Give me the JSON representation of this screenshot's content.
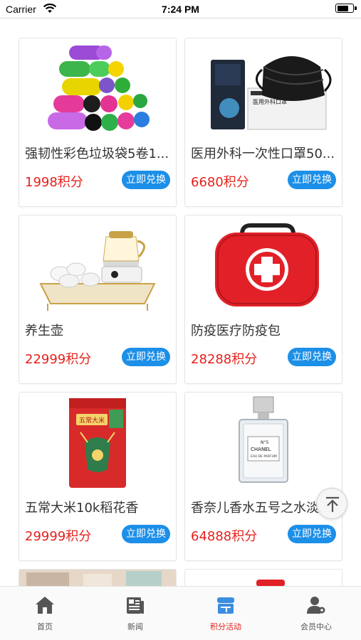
{
  "status_bar": {
    "carrier": "Carrier",
    "time": "7:24 PM"
  },
  "products": [
    {
      "title": "强韧性彩色垃圾袋5卷1...",
      "price": "1998积分",
      "button": "立即兑换",
      "image": "colorful-garbage-bag-rolls"
    },
    {
      "title": "医用外科一次性口罩50...",
      "price": "6680积分",
      "button": "立即兑换",
      "image": "disposable-mask-box"
    },
    {
      "title": "养生壶",
      "price": "22999积分",
      "button": "立即兑换",
      "image": "health-kettle-set"
    },
    {
      "title": "防疫医疗防疫包",
      "price": "28288积分",
      "button": "立即兑换",
      "image": "red-medical-kit"
    },
    {
      "title": "五常大米10k稻花香",
      "price": "29999积分",
      "button": "立即兑换",
      "image": "wuchang-rice-bag"
    },
    {
      "title": "香奈儿香水五号之水淡...",
      "price": "64888积分",
      "button": "立即兑换",
      "image": "chanel-perfume-bottle"
    }
  ],
  "perfume_label": {
    "brand": "CHANEL",
    "line1": "N°5",
    "line2": "EAU DE PARFUM"
  },
  "mask_box_label": "医用外科口罩",
  "rice_label": "五常大米",
  "tabbar": {
    "tabs": [
      {
        "label": "首页",
        "icon": "home-icon"
      },
      {
        "label": "新闻",
        "icon": "news-icon"
      },
      {
        "label": "积分活动",
        "icon": "points-store-icon"
      },
      {
        "label": "会员中心",
        "icon": "member-settings-icon"
      }
    ],
    "active_index": 2
  },
  "colors": {
    "price": "#e3221d",
    "button": "#1c8fe8",
    "tab_active": "#e3221d",
    "tab_active_icon": "#3b8de0",
    "tab_icon": "#555555"
  }
}
